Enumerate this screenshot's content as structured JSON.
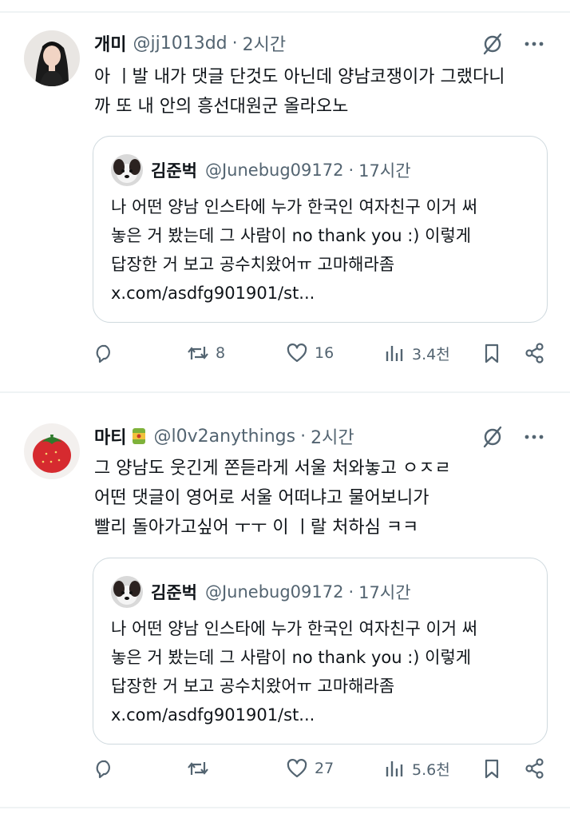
{
  "tweets": [
    {
      "name": "개미",
      "handle": "@jj1013dd",
      "time": "2시간",
      "lines": [
        "아 ㅣ발 내가 댓글 단것도 아닌데 양남코쟁이가 그랬다니",
        "까 또 내 안의 흥선대원군 올라오노"
      ],
      "quote": {
        "name": "김준벅",
        "handle": "@Junebug09172",
        "time": "17시간",
        "lines": [
          "나 어떤 양남 인스타에 누가 한국인 여자친구 이거 써",
          "놓은 거 봤는데 그 사람이 no thank you :) 이렇게",
          "답장한 거 보고 공수치왔어ㅠ 고마해라좀",
          "x.com/asdfg901901/st..."
        ]
      },
      "stats": {
        "replies": "",
        "reposts": "8",
        "likes": "16",
        "views": "3.4천"
      }
    },
    {
      "name": "마티",
      "handle": "@l0v2anythings",
      "time": "2시간",
      "lines": [
        "그 양남도 웃긴게 쫀듣라게 서울 처와놓고 ㅇㅈㄹ",
        "어떤 댓글이 영어로 서울 어떠냐고 물어보니가",
        "빨리 돌아가고싶어 ㅜㅜ 이 ㅣ랄 처하심 ㅋㅋ"
      ],
      "quote": {
        "name": "김준벅",
        "handle": "@Junebug09172",
        "time": "17시간",
        "lines": [
          "나 어떤 양남 인스타에 누가 한국인 여자친구 이거 써",
          "놓은 거 봤는데 그 사람이 no thank you :) 이렇게",
          "답장한 거 보고 공수치왔어ㅠ 고마해라좀",
          "x.com/asdfg901901/st..."
        ]
      },
      "stats": {
        "replies": "",
        "reposts": "",
        "likes": "27",
        "views": "5.6천"
      }
    }
  ],
  "icons": [
    "reply-icon",
    "repost-icon",
    "like-icon",
    "views-icon",
    "bookmark-icon",
    "share-icon",
    "grok-icon",
    "more-icon"
  ],
  "colors": {
    "text": "#0f1419",
    "secondary": "#536471",
    "border": "#cfd9de",
    "separator": "#eff3f4"
  }
}
